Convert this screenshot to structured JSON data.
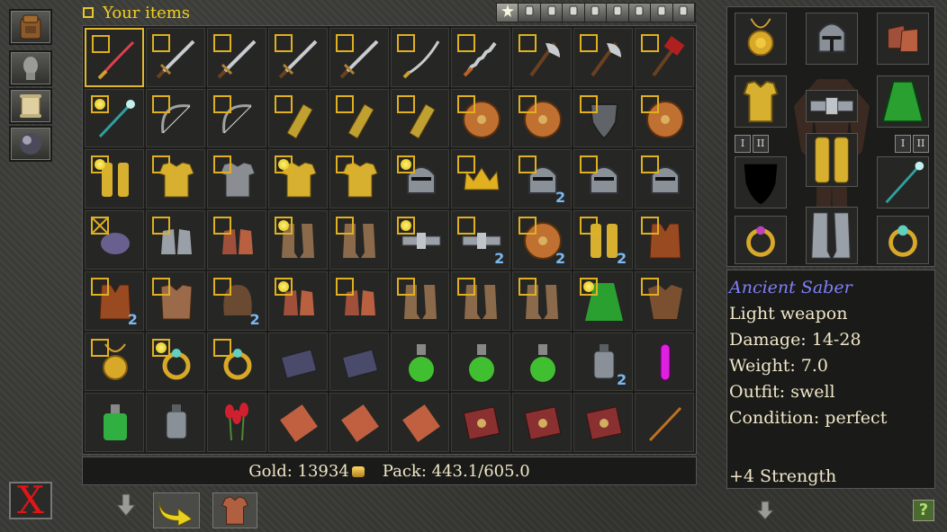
{
  "header": {
    "title": "Your items"
  },
  "filters": [
    {
      "icon": "all-items-icon"
    },
    {
      "icon": "weapons-icon"
    },
    {
      "icon": "armor-icon"
    },
    {
      "icon": "rings-icon"
    },
    {
      "icon": "books-icon"
    },
    {
      "icon": "scrolls-icon"
    },
    {
      "icon": "potions-icon"
    },
    {
      "icon": "wands-icon"
    },
    {
      "icon": "misc-icon"
    }
  ],
  "inventory": [
    {
      "icon": "saber-icon",
      "checked": false,
      "selected": true
    },
    {
      "icon": "longsword-icon",
      "checked": false
    },
    {
      "icon": "broadsword-icon",
      "checked": false
    },
    {
      "icon": "sword-icon",
      "checked": false
    },
    {
      "icon": "sword-icon",
      "checked": false
    },
    {
      "icon": "scimitar-icon",
      "checked": false
    },
    {
      "icon": "flamberge-icon",
      "checked": false
    },
    {
      "icon": "battleaxe-icon",
      "checked": false
    },
    {
      "icon": "axe-icon",
      "checked": false
    },
    {
      "icon": "hammer-icon",
      "checked": false
    },
    {
      "icon": "staff-icon",
      "marked": true
    },
    {
      "icon": "bow-icon",
      "checked": false
    },
    {
      "icon": "bow-icon",
      "checked": false
    },
    {
      "icon": "bracer-icon",
      "checked": false
    },
    {
      "icon": "bracer-icon",
      "checked": false
    },
    {
      "icon": "bracer-icon",
      "checked": false
    },
    {
      "icon": "round-shield-icon",
      "checked": false
    },
    {
      "icon": "round-shield-icon",
      "checked": false
    },
    {
      "icon": "kite-shield-icon",
      "checked": false
    },
    {
      "icon": "round-shield-icon",
      "checked": false
    },
    {
      "icon": "greaves-icon",
      "marked": true
    },
    {
      "icon": "breastplate-icon",
      "checked": false
    },
    {
      "icon": "chainmail-icon",
      "checked": false
    },
    {
      "icon": "breastplate-icon",
      "marked": true
    },
    {
      "icon": "breastplate-icon",
      "checked": false
    },
    {
      "icon": "horned-helm-icon",
      "marked": true
    },
    {
      "icon": "crown-icon",
      "checked": false
    },
    {
      "icon": "helm-icon",
      "checked": false,
      "count": "2"
    },
    {
      "icon": "helm-icon",
      "checked": false
    },
    {
      "icon": "helm-icon",
      "checked": false
    },
    {
      "icon": "mask-icon",
      "crossed": true
    },
    {
      "icon": "gauntlets-icon",
      "checked": false
    },
    {
      "icon": "gloves-icon",
      "checked": false
    },
    {
      "icon": "boots-icon",
      "marked": true
    },
    {
      "icon": "boots-icon",
      "checked": false
    },
    {
      "icon": "belt-icon",
      "marked": true
    },
    {
      "icon": "belt-icon",
      "checked": false,
      "count": "2"
    },
    {
      "icon": "round-shield-icon",
      "checked": false,
      "count": "2"
    },
    {
      "icon": "greaves-icon",
      "checked": false,
      "count": "2"
    },
    {
      "icon": "vest-icon",
      "checked": false
    },
    {
      "icon": "vest-icon",
      "checked": false,
      "count": "2"
    },
    {
      "icon": "leather-armor-icon",
      "checked": false
    },
    {
      "icon": "hood-icon",
      "checked": false,
      "count": "2"
    },
    {
      "icon": "gloves-icon",
      "marked": true
    },
    {
      "icon": "gloves-icon",
      "checked": false
    },
    {
      "icon": "boots-icon",
      "checked": false
    },
    {
      "icon": "boots-icon",
      "checked": false
    },
    {
      "icon": "boots-icon",
      "checked": false
    },
    {
      "icon": "cloak-icon",
      "marked": true
    },
    {
      "icon": "tunic-icon",
      "checked": false
    },
    {
      "icon": "amulet-icon",
      "checked": false
    },
    {
      "icon": "ring-icon",
      "marked": true
    },
    {
      "icon": "ring-icon",
      "checked": false
    },
    {
      "icon": "book-icon"
    },
    {
      "icon": "book-icon"
    },
    {
      "icon": "potion-icon"
    },
    {
      "icon": "potion-icon"
    },
    {
      "icon": "potion-icon"
    },
    {
      "icon": "lantern-icon",
      "count": "2"
    },
    {
      "icon": "vial-icon"
    },
    {
      "icon": "bottle-icon"
    },
    {
      "icon": "lantern-icon"
    },
    {
      "icon": "herb-icon"
    },
    {
      "icon": "scroll-icon"
    },
    {
      "icon": "scroll-icon"
    },
    {
      "icon": "scroll-icon"
    },
    {
      "icon": "spellbook-icon"
    },
    {
      "icon": "spellbook-icon"
    },
    {
      "icon": "spellbook-icon"
    },
    {
      "icon": "wand-icon"
    }
  ],
  "status": {
    "gold_label": "Gold:",
    "gold_value": "13934",
    "pack_label": "Pack:",
    "pack_value": "443.1/605.0"
  },
  "equipment": {
    "hand_labels": [
      "I",
      "II",
      "I",
      "II"
    ]
  },
  "item_info": {
    "name": "Ancient Saber",
    "lines": [
      "Light weapon",
      "Damage: 14-28",
      "Weight: 7.0",
      "Outfit: swell",
      "Condition: perfect"
    ],
    "bonus": "+4 Strength"
  },
  "help_label": "?",
  "close_label": "X",
  "colors": {
    "accent": "#f0d020",
    "count": "#7ab8f0",
    "item_name": "#8080f8",
    "close": "#e01616"
  }
}
